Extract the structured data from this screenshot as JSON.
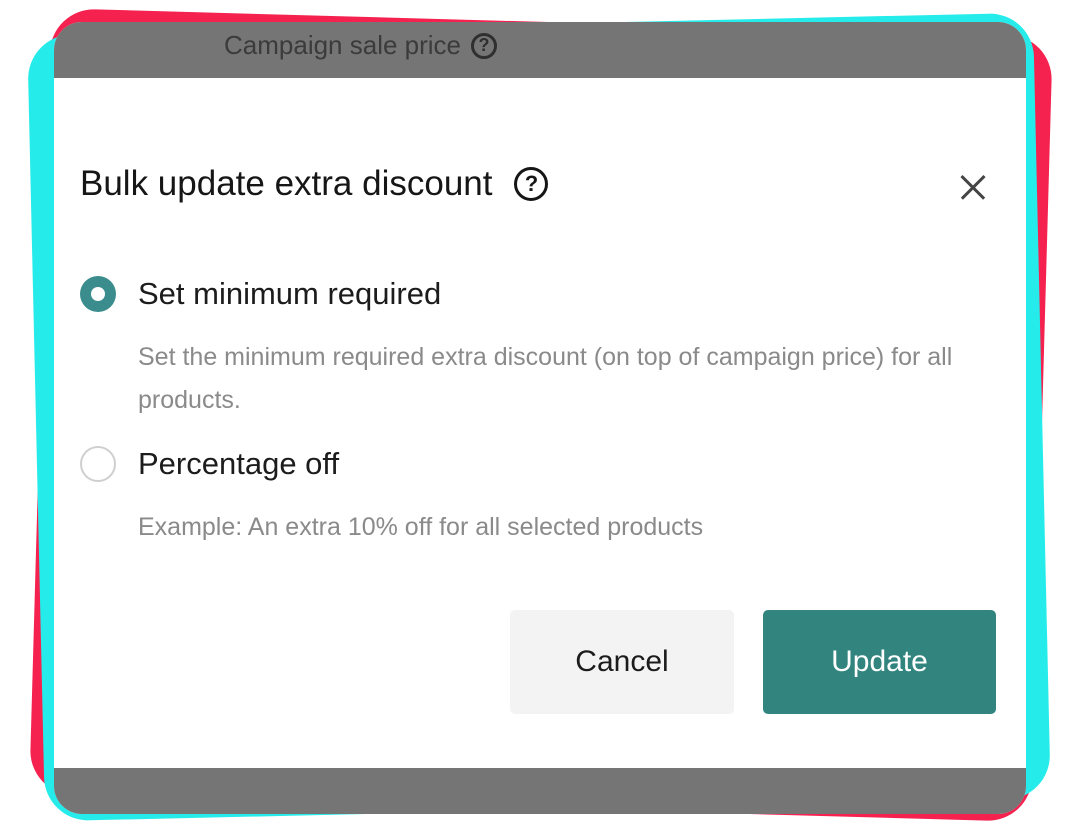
{
  "backdrop": {
    "label": "Campaign sale price"
  },
  "dialog": {
    "title": "Bulk update extra discount",
    "options": [
      {
        "label": "Set minimum required",
        "description": "Set the minimum required extra discount (on top of campaign price) for all products.",
        "selected": true
      },
      {
        "label": "Percentage off",
        "description": "Example: An extra 10% off for all selected products",
        "selected": false
      }
    ],
    "cancel_label": "Cancel",
    "update_label": "Update"
  },
  "icons": {
    "help": "question-circle-icon",
    "close": "close-icon"
  },
  "colors": {
    "accent": "#32857f",
    "frame_red": "#f5214f",
    "frame_cyan": "#25ecea",
    "overlay": "#757575"
  }
}
